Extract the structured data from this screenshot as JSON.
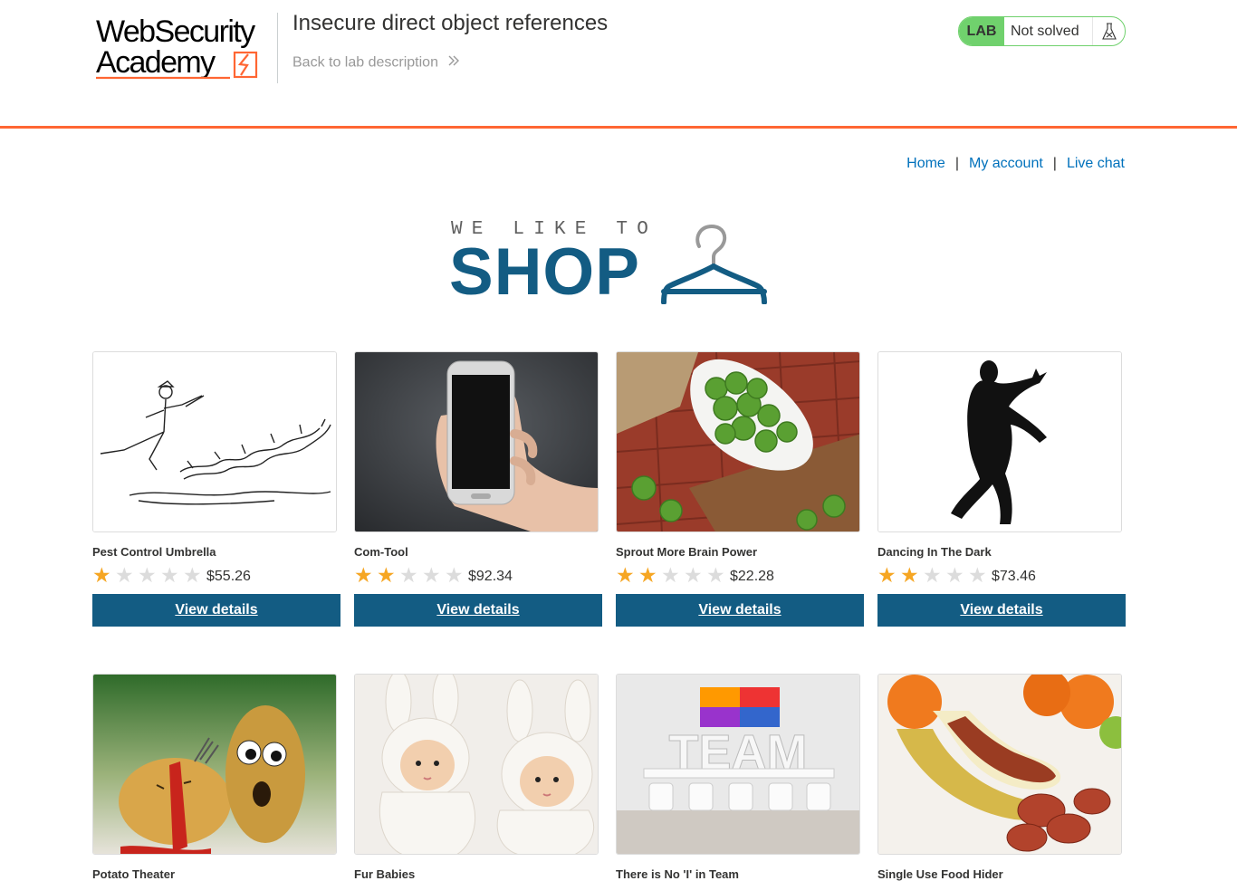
{
  "header": {
    "logo_line1": "WebSecurity",
    "logo_line2": "Academy",
    "lab_title": "Insecure direct object references",
    "back_link": "Back to lab description",
    "lab_badge": "LAB",
    "lab_status": "Not solved",
    "accent_color": "#ff6633",
    "status_color": "#70d16d"
  },
  "nav": {
    "home": "Home",
    "separator": "|",
    "my_account": "My account",
    "live_chat": "Live chat"
  },
  "shop_logo": {
    "tagline": "WE LIKE TO",
    "word": "SHOP",
    "brand_color": "#135c83"
  },
  "products": [
    {
      "name": "Pest Control Umbrella",
      "rating": 1,
      "price": "$55.26",
      "button": "View details",
      "image": "umbrella-sketch"
    },
    {
      "name": "Com-Tool",
      "rating": 2,
      "price": "$92.34",
      "button": "View details",
      "image": "phone-in-hand"
    },
    {
      "name": "Sprout More Brain Power",
      "rating": 2,
      "price": "$22.28",
      "button": "View details",
      "image": "brussels-sprouts"
    },
    {
      "name": "Dancing In The Dark",
      "rating": 2,
      "price": "$73.46",
      "button": "View details",
      "image": "dancer-silhouette"
    },
    {
      "name": "Potato Theater",
      "rating": 0,
      "price": "",
      "button": "",
      "image": "potatoes"
    },
    {
      "name": "Fur Babies",
      "rating": 0,
      "price": "",
      "button": "",
      "image": "babies-in-bunny-hats"
    },
    {
      "name": "There is No 'I' in Team",
      "rating": 0,
      "price": "",
      "button": "",
      "image": "team-meeting-room"
    },
    {
      "name": "Single Use Food Hider",
      "rating": 0,
      "price": "",
      "button": "",
      "image": "banana-sausage"
    }
  ]
}
